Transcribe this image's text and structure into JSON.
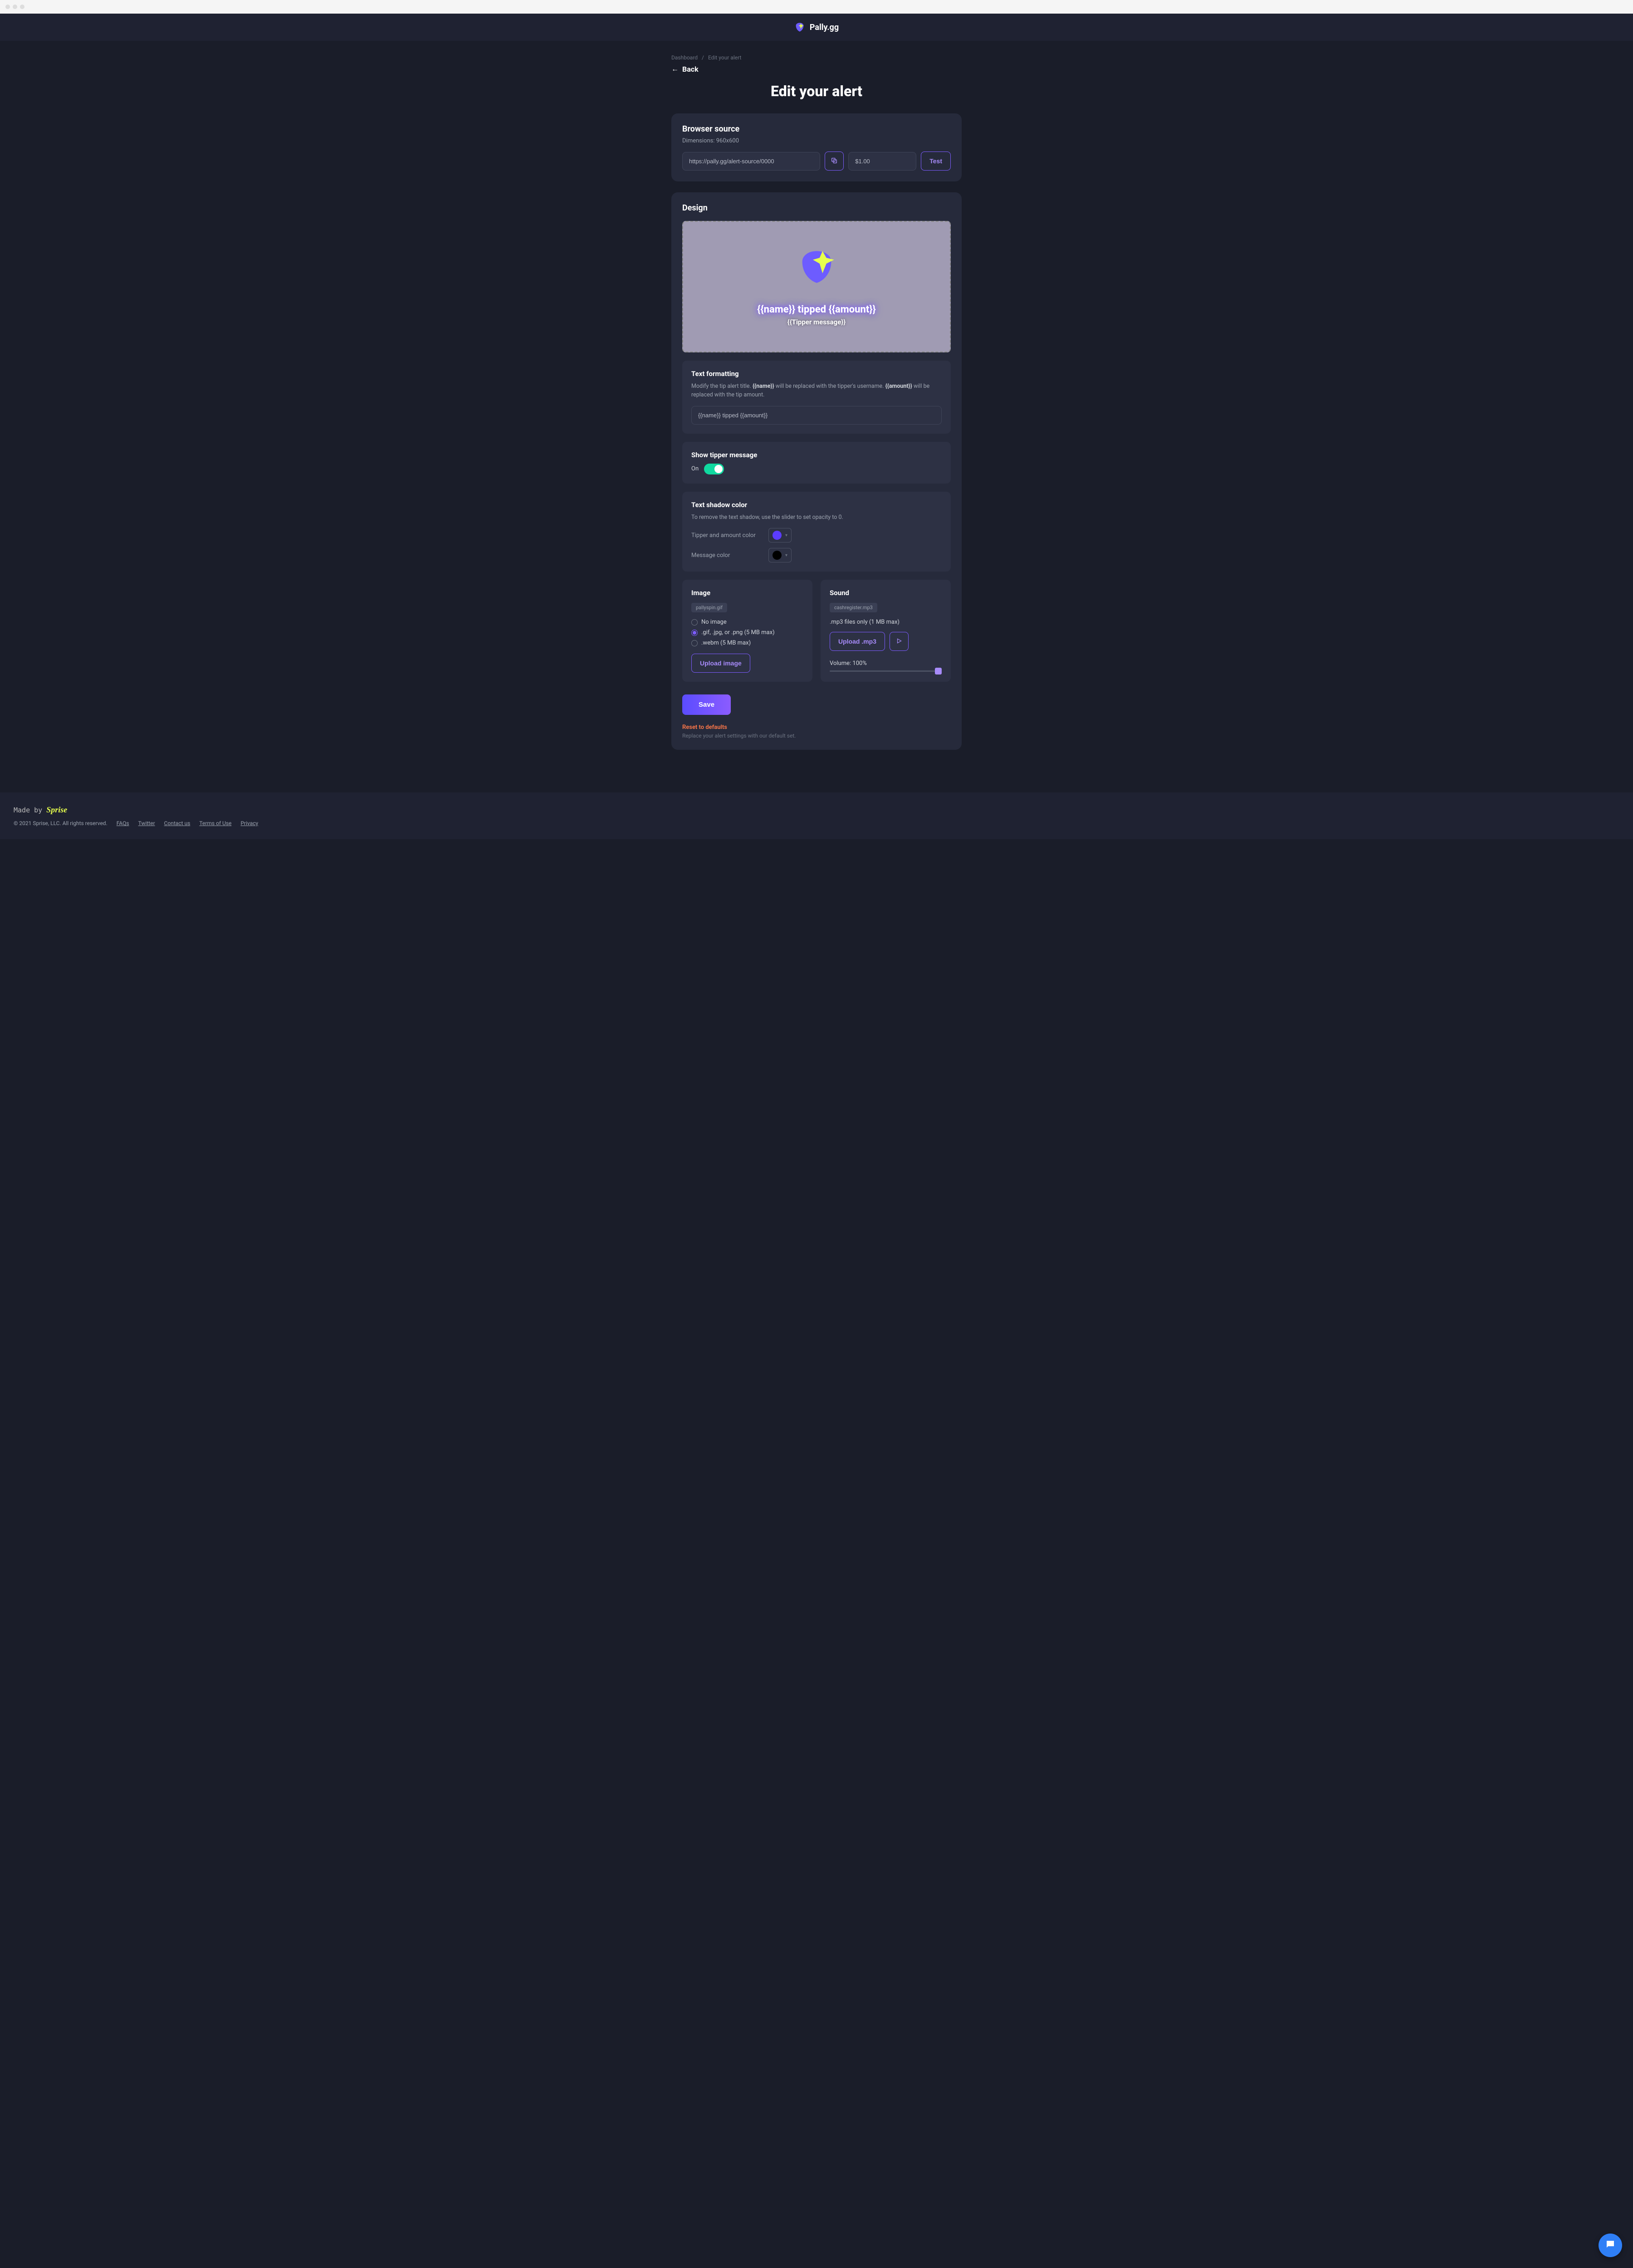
{
  "header": {
    "brand": "Pally.gg"
  },
  "breadcrumb": {
    "root": "Dashboard",
    "current": "Edit your alert"
  },
  "back": {
    "label": "Back"
  },
  "page": {
    "title": "Edit your alert"
  },
  "browserSource": {
    "title": "Browser source",
    "dimensions": "Dimensions: 960x600",
    "url": "https://pally.gg/alert-source/0000",
    "amount": "$1.00",
    "testLabel": "Test"
  },
  "design": {
    "title": "Design",
    "previewTitle": "{{name}} tipped {{amount}}",
    "previewMessage": "{{Tipper message}}"
  },
  "textFormatting": {
    "title": "Text formatting",
    "descPrefix": "Modify the tip alert title. ",
    "nameToken": "{{name}}",
    "descMid": " will be replaced with the tipper's username. ",
    "amountToken": "{{amount}}",
    "descSuffix": " will be replaced with the tip amount.",
    "value": "{{name}} tipped {{amount}}"
  },
  "tipperMessage": {
    "title": "Show tipper message",
    "stateLabel": "On"
  },
  "textShadow": {
    "title": "Text shadow color",
    "desc": "To remove the text shadow, use the slider to set opacity to 0.",
    "tipperLabel": "Tipper and amount color",
    "tipperColor": "#5b3cff",
    "messageLabel": "Message color",
    "messageColor": "#000000"
  },
  "image": {
    "title": "Image",
    "filename": "pallyspin.gif",
    "options": [
      {
        "label": "No image",
        "checked": false
      },
      {
        "label": ".gif, .jpg, or .png (5 MB max)",
        "checked": true
      },
      {
        "label": ".webm (5 MB max)",
        "checked": false
      }
    ],
    "uploadLabel": "Upload image"
  },
  "sound": {
    "title": "Sound",
    "filename": "cashregister.mp3",
    "hint": ".mp3 files only (1 MB max)",
    "uploadLabel": "Upload .mp3",
    "volumeLabel": "Volume: 100%"
  },
  "actions": {
    "save": "Save",
    "resetLabel": "Reset to defaults",
    "resetDesc": "Replace your alert settings with our default set."
  },
  "footer": {
    "madeBy": "Made by",
    "sprise": "Sprise",
    "copyright": "© 2021 Sprise, LLC. All rights reserved.",
    "links": [
      "FAQs",
      "Twitter",
      "Contact us",
      "Terms of Use",
      "Privacy"
    ]
  }
}
